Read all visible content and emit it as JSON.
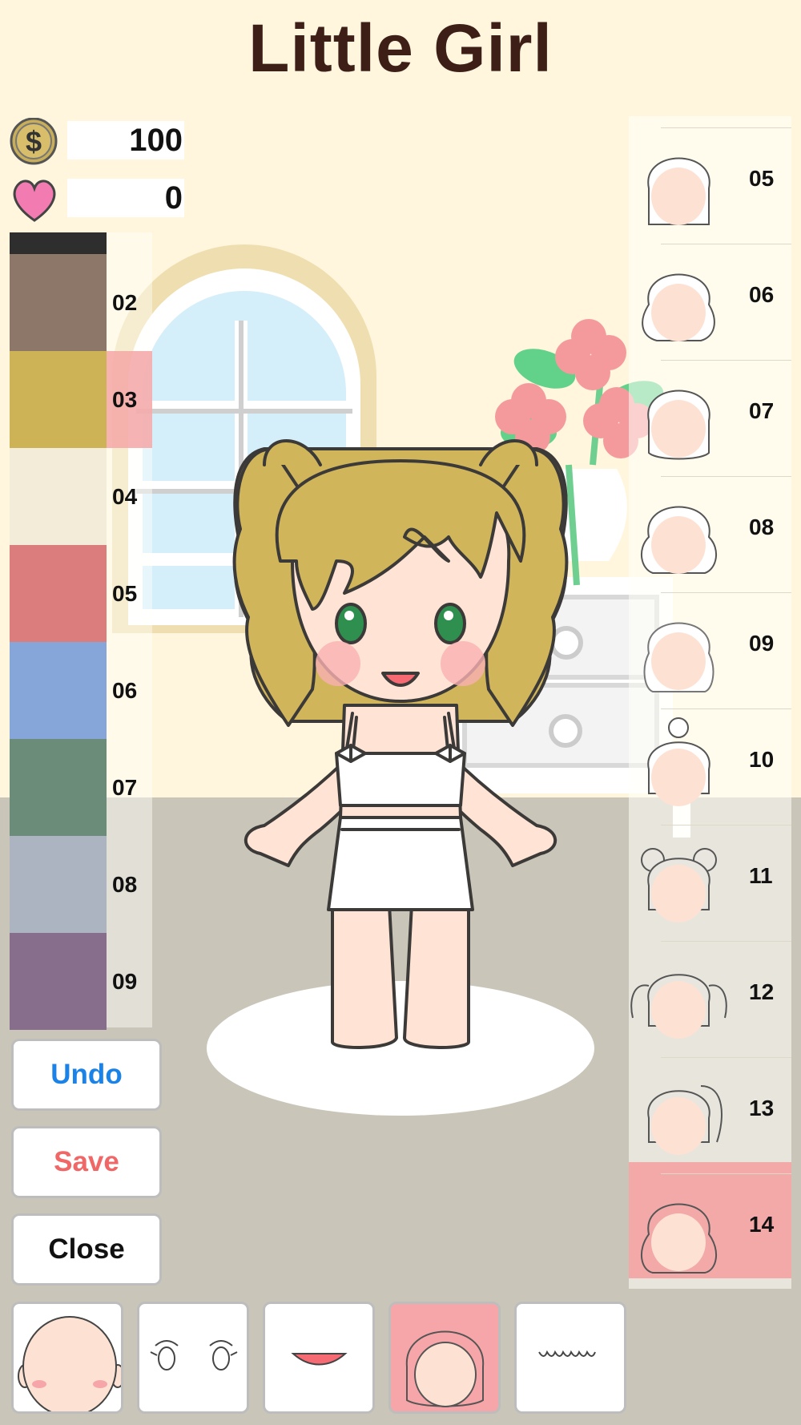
{
  "app": {
    "title": "Little Girl"
  },
  "stats": {
    "coins": "100",
    "hearts": "0"
  },
  "colors": {
    "items": [
      {
        "label": "02",
        "color": "#8c7768"
      },
      {
        "label": "03",
        "color": "#cdb356"
      },
      {
        "label": "04",
        "color": "#f3ecd8"
      },
      {
        "label": "05",
        "color": "#db7c7d"
      },
      {
        "label": "06",
        "color": "#86a6d9"
      },
      {
        "label": "07",
        "color": "#6a8c79"
      },
      {
        "label": "08",
        "color": "#adb4c1"
      },
      {
        "label": "09",
        "color": "#876e8d"
      }
    ],
    "selected": "03"
  },
  "actions": {
    "undo": "Undo",
    "save": "Save",
    "close": "Close"
  },
  "hair": {
    "items": [
      {
        "label": "05",
        "style": "bob"
      },
      {
        "label": "06",
        "style": "wavy-bob"
      },
      {
        "label": "07",
        "style": "scalloped"
      },
      {
        "label": "08",
        "style": "curly"
      },
      {
        "label": "09",
        "style": "wavy-long"
      },
      {
        "label": "10",
        "style": "topknot"
      },
      {
        "label": "11",
        "style": "buns"
      },
      {
        "label": "12",
        "style": "pigtails"
      },
      {
        "label": "13",
        "style": "side-ponytail"
      },
      {
        "label": "14",
        "style": "twin-curls"
      }
    ],
    "selected": "14"
  },
  "categories": [
    {
      "name": "face-icon"
    },
    {
      "name": "eyes-icon"
    },
    {
      "name": "mouth-icon"
    },
    {
      "name": "hair-icon"
    },
    {
      "name": "bangs-icon"
    }
  ],
  "theme": {
    "accent": "#f6a6a8",
    "undo_color": "#1b82e8",
    "save_color": "#f06767",
    "close_color": "#111111",
    "title_color": "#3e1f17"
  }
}
